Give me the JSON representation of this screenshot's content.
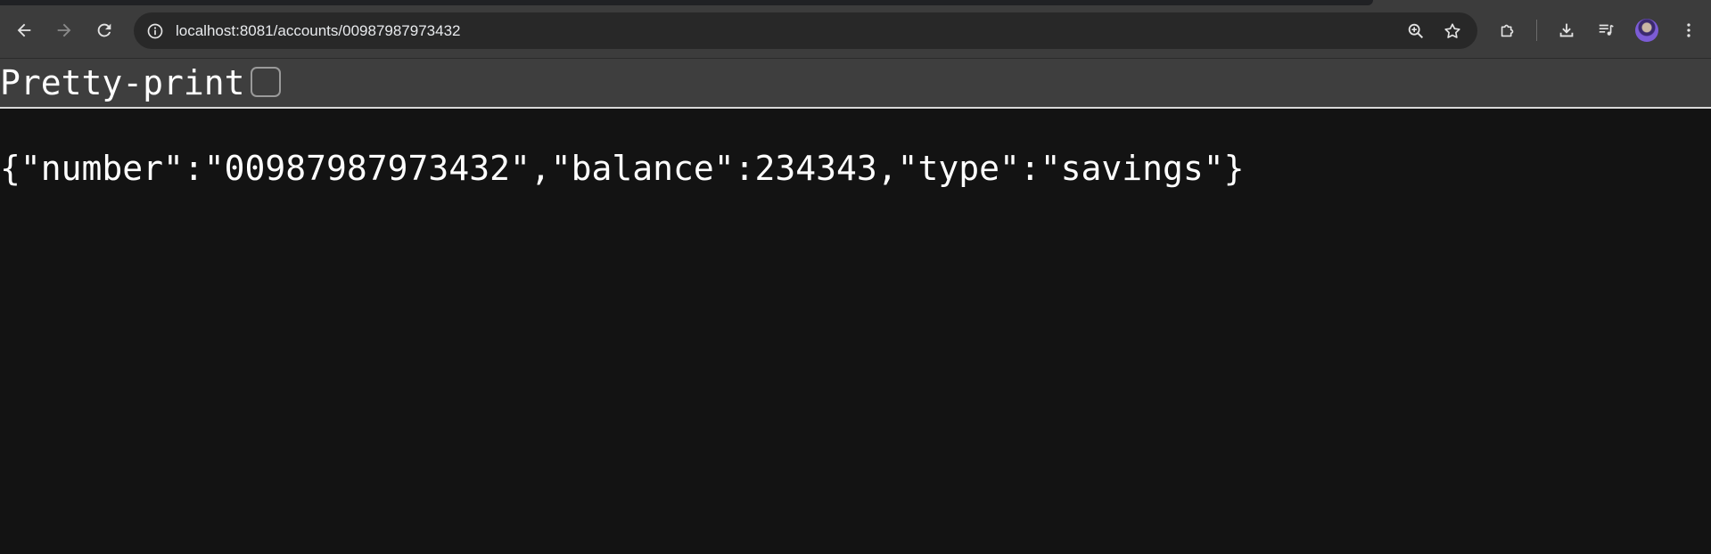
{
  "browser": {
    "url": "localhost:8081/accounts/00987987973432",
    "icons": {
      "back": "arrow-left-icon",
      "forward": "arrow-right-icon",
      "reload": "reload-icon",
      "site_info": "info-icon",
      "zoom": "zoom-in-icon",
      "bookmark": "star-icon",
      "extensions": "puzzle-icon",
      "downloads": "download-icon",
      "media": "media-playlist-icon",
      "profile": "avatar-icon",
      "menu": "kebab-menu-icon"
    }
  },
  "viewer": {
    "pretty_print_label": "Pretty-print",
    "pretty_print_checked": false,
    "json_text": "{\"number\":\"00987987973432\",\"balance\":234343,\"type\":\"savings\"}"
  },
  "colors": {
    "page_background": "#131313",
    "toolbar_background": "#3c3c3c",
    "omnibox_background": "#282828",
    "text": "#ffffff"
  }
}
